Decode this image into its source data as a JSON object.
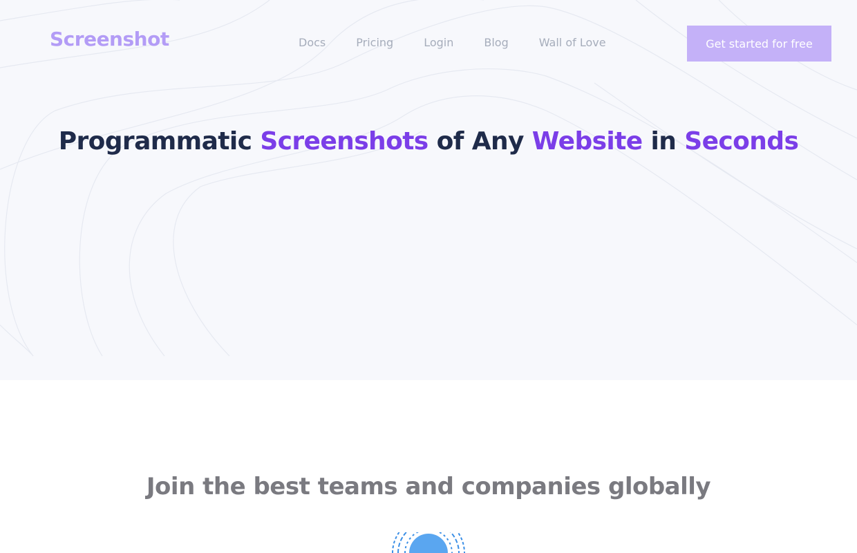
{
  "brand": {
    "logo_text": "Screenshot",
    "logo_color": "#b39cf6"
  },
  "nav": {
    "links": [
      "Docs",
      "Pricing",
      "Login",
      "Blog",
      "Wall of Love"
    ],
    "cta_label": "Get started for free"
  },
  "hero": {
    "headline_parts": [
      {
        "text": "Programmatic ",
        "highlight": false
      },
      {
        "text": "Screenshots",
        "highlight": true
      },
      {
        "text": " of Any ",
        "highlight": false
      },
      {
        "text": "Website",
        "highlight": true
      },
      {
        "text": " in ",
        "highlight": false
      },
      {
        "text": "Seconds",
        "highlight": true
      }
    ],
    "accent_color": "#7b3ee8"
  },
  "companies": {
    "title": "Join the best teams and companies globally",
    "first_logo_icon": "circular-dotted-logo-icon"
  }
}
